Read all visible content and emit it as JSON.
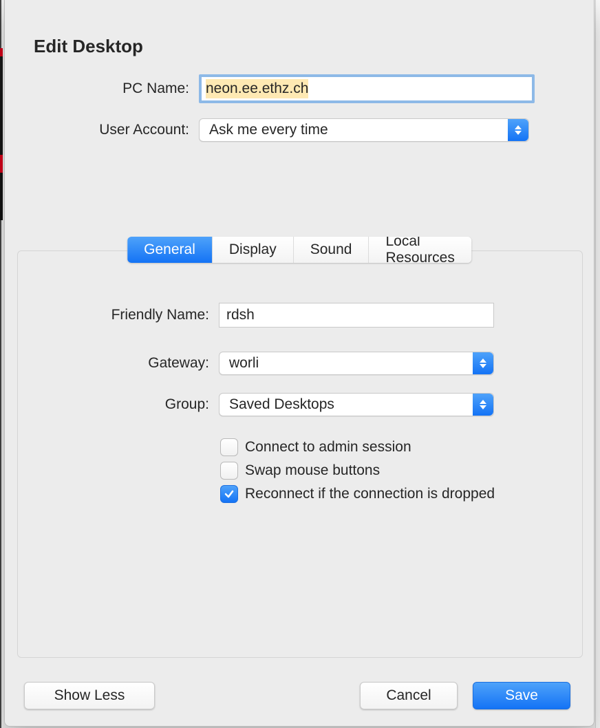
{
  "title": "Edit Desktop",
  "form": {
    "pc_name_label": "PC Name:",
    "pc_name_value": "neon.ee.ethz.ch",
    "user_account_label": "User Account:",
    "user_account_value": "Ask me every time"
  },
  "tabs": {
    "general": "General",
    "display": "Display",
    "sound": "Sound",
    "local_resources": "Local Resources",
    "active": "general"
  },
  "general": {
    "friendly_name_label": "Friendly Name:",
    "friendly_name_value": "rdsh",
    "gateway_label": "Gateway:",
    "gateway_value": "worli",
    "group_label": "Group:",
    "group_value": "Saved Desktops",
    "checkboxes": {
      "admin_session": {
        "label": "Connect to admin session",
        "checked": false
      },
      "swap_mouse": {
        "label": "Swap mouse buttons",
        "checked": false
      },
      "reconnect": {
        "label": "Reconnect if the connection is dropped",
        "checked": true
      }
    }
  },
  "buttons": {
    "show_less": "Show Less",
    "cancel": "Cancel",
    "save": "Save"
  }
}
